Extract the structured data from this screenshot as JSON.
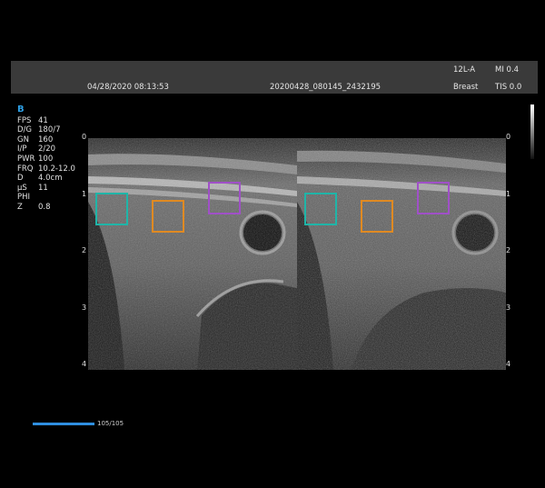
{
  "header": {
    "date": "04/28/2020 08:13:53",
    "exam_id": "20200428_080145_2432195",
    "probe": "12L-A",
    "preset": "Breast",
    "mi": "MI 0.4",
    "tis": "TIS 0.0"
  },
  "params": {
    "mode": "B",
    "rows": [
      {
        "key": "FPS",
        "value": "41"
      },
      {
        "key": "D/G",
        "value": "180/7"
      },
      {
        "key": "GN",
        "value": "160"
      },
      {
        "key": "I/P",
        "value": "2/20"
      },
      {
        "key": "PWR",
        "value": "100"
      },
      {
        "key": "FRQ",
        "value": "10.2-12.0"
      },
      {
        "key": "D",
        "value": "4.0cm"
      },
      {
        "key": "µS",
        "value": "11"
      },
      {
        "key": "PHI",
        "value": ""
      },
      {
        "key": "Z",
        "value": "0.8"
      }
    ]
  },
  "depth_scale": [
    "0",
    "1",
    "2",
    "3",
    "4"
  ],
  "roi_colors": {
    "teal": "#1fb5a8",
    "orange": "#e08a22",
    "purple": "#a050c8"
  },
  "progress": {
    "label": "105/105",
    "fraction": 1.0
  }
}
